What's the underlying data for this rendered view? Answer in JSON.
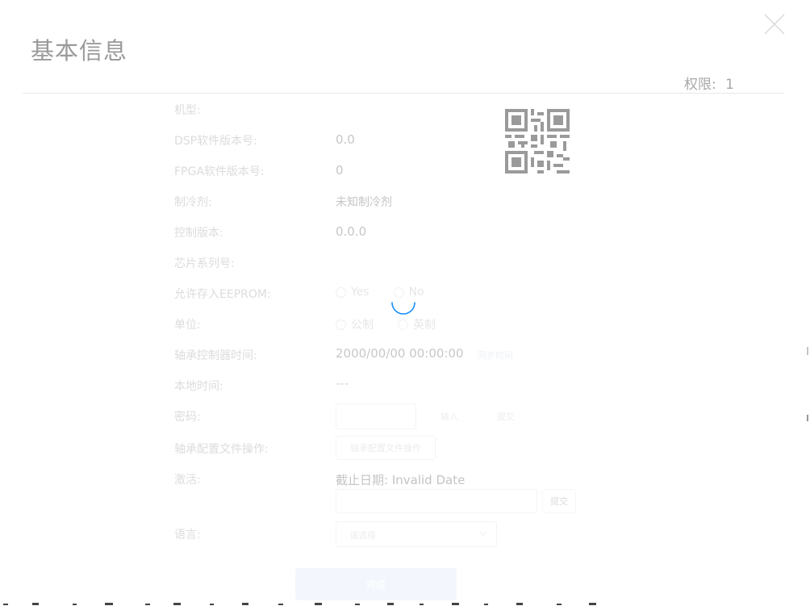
{
  "dialog": {
    "title": "基本信息",
    "permission_label": "权限:",
    "permission_value": "1"
  },
  "fields": {
    "model": {
      "label": "机型:",
      "value": ""
    },
    "dsp_version": {
      "label": "DSP软件版本号:",
      "value": "0.0"
    },
    "fpga_version": {
      "label": "FPGA软件版本号:",
      "value": "0"
    },
    "refrigerant": {
      "label": "制冷剂:",
      "value": "未知制冷剂"
    },
    "control_version": {
      "label": "控制版本:",
      "value": "0.0.0"
    },
    "chip_series": {
      "label": "芯片系列号:",
      "value": ""
    },
    "allow_eeprom": {
      "label": "允许存入EEPROM:",
      "options": [
        "Yes",
        "No"
      ],
      "selected": "No"
    },
    "unit": {
      "label": "单位:",
      "options": [
        "公制",
        "英制"
      ],
      "selected": "英制"
    },
    "controller_time": {
      "label": "轴承控制器时间:",
      "value": "2000/00/00 00:00:00",
      "sync_label": "同步时间"
    },
    "local_time": {
      "label": "本地时间:",
      "value": "---"
    },
    "password": {
      "label": "密码:",
      "input_value": "",
      "enter_label": "输入",
      "submit_label": "提交"
    },
    "config_file": {
      "label": "轴承配置文件操作:",
      "button_label": "轴承配置文件操作"
    },
    "activation": {
      "label": "激活:",
      "deadline_label": "截止日期:",
      "deadline_value": "Invalid Date",
      "input_value": "",
      "submit_label": "提交"
    },
    "language": {
      "label": "语言:",
      "placeholder": "请选择"
    }
  },
  "footer": {
    "confirm_label": "完成"
  },
  "icons": {
    "close": "close-icon",
    "qr": "qr-code-icon",
    "spinner": "loading-spinner-icon",
    "chevron": "chevron-down-icon"
  },
  "colors": {
    "accent": "#1890ff"
  }
}
